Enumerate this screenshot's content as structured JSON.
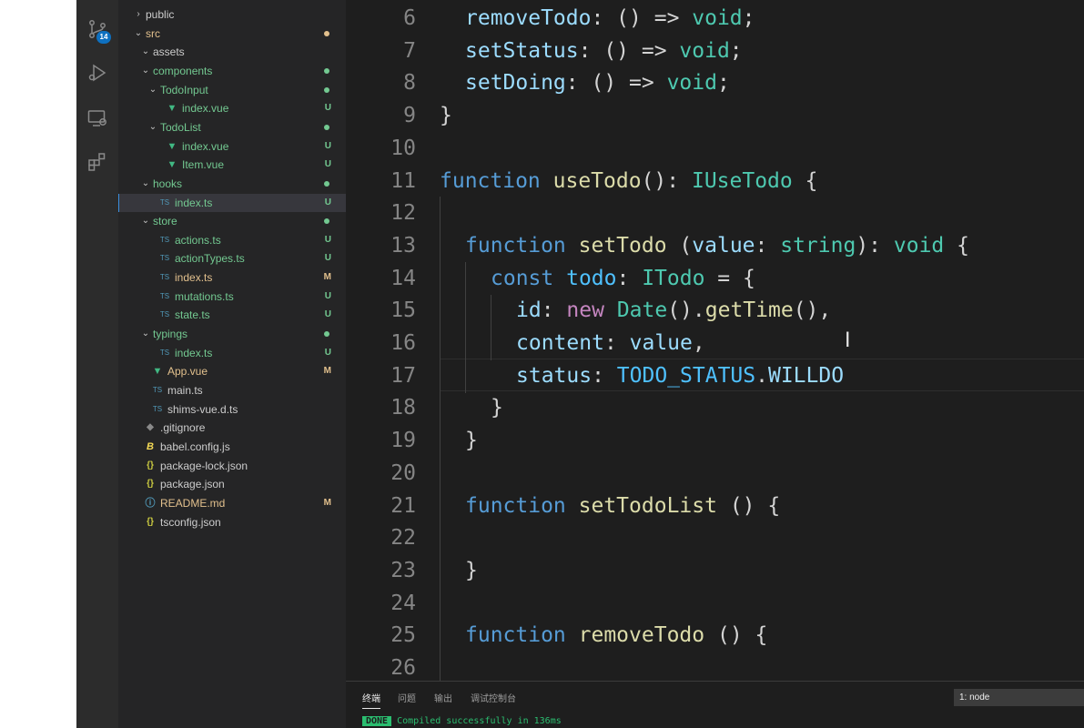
{
  "activity_bar": {
    "badge": "14",
    "icons": [
      "source-control-icon",
      "run-debug-icon",
      "remote-explorer-icon",
      "extensions-icon"
    ]
  },
  "explorer": {
    "items": [
      {
        "label": "public",
        "depth": 0,
        "type": "folder",
        "expanded": false,
        "status": ""
      },
      {
        "label": "src",
        "depth": 0,
        "type": "folder",
        "expanded": true,
        "status": "dot-yellow"
      },
      {
        "label": "assets",
        "depth": 1,
        "type": "folder",
        "expanded": true,
        "status": ""
      },
      {
        "label": "components",
        "depth": 1,
        "type": "folder",
        "expanded": true,
        "status": "dot-green"
      },
      {
        "label": "TodoInput",
        "depth": 2,
        "type": "folder",
        "expanded": true,
        "status": "dot-green"
      },
      {
        "label": "index.vue",
        "depth": 3,
        "type": "vue",
        "status": "U"
      },
      {
        "label": "TodoList",
        "depth": 2,
        "type": "folder",
        "expanded": true,
        "status": "dot-green"
      },
      {
        "label": "index.vue",
        "depth": 3,
        "type": "vue",
        "status": "U"
      },
      {
        "label": "Item.vue",
        "depth": 3,
        "type": "vue",
        "status": "U"
      },
      {
        "label": "hooks",
        "depth": 1,
        "type": "folder",
        "expanded": true,
        "status": "dot-green"
      },
      {
        "label": "index.ts",
        "depth": 2,
        "type": "ts",
        "status": "U",
        "selected": true
      },
      {
        "label": "store",
        "depth": 1,
        "type": "folder",
        "expanded": true,
        "status": "dot-green"
      },
      {
        "label": "actions.ts",
        "depth": 2,
        "type": "ts",
        "status": "U"
      },
      {
        "label": "actionTypes.ts",
        "depth": 2,
        "type": "ts",
        "status": "U"
      },
      {
        "label": "index.ts",
        "depth": 2,
        "type": "ts",
        "status": "M"
      },
      {
        "label": "mutations.ts",
        "depth": 2,
        "type": "ts",
        "status": "U"
      },
      {
        "label": "state.ts",
        "depth": 2,
        "type": "ts",
        "status": "U"
      },
      {
        "label": "typings",
        "depth": 1,
        "type": "folder",
        "expanded": true,
        "status": "dot-green"
      },
      {
        "label": "index.ts",
        "depth": 2,
        "type": "ts",
        "status": "U"
      },
      {
        "label": "App.vue",
        "depth": 1,
        "type": "vue",
        "status": "M"
      },
      {
        "label": "main.ts",
        "depth": 1,
        "type": "ts",
        "status": ""
      },
      {
        "label": "shims-vue.d.ts",
        "depth": 1,
        "type": "ts",
        "status": ""
      },
      {
        "label": ".gitignore",
        "depth": 0,
        "type": "git",
        "status": ""
      },
      {
        "label": "babel.config.js",
        "depth": 0,
        "type": "babel",
        "status": ""
      },
      {
        "label": "package-lock.json",
        "depth": 0,
        "type": "json",
        "status": ""
      },
      {
        "label": "package.json",
        "depth": 0,
        "type": "json",
        "status": ""
      },
      {
        "label": "README.md",
        "depth": 0,
        "type": "info",
        "status": "M"
      },
      {
        "label": "tsconfig.json",
        "depth": 0,
        "type": "json",
        "status": ""
      }
    ]
  },
  "editor": {
    "lines": [
      {
        "n": "6",
        "indent": 1,
        "tokens": [
          {
            "t": "removeTodo",
            "c": "prop"
          },
          {
            "t": ": () => ",
            "c": "p"
          },
          {
            "t": "void",
            "c": "ty"
          },
          {
            "t": ";",
            "c": "p"
          }
        ]
      },
      {
        "n": "7",
        "indent": 1,
        "tokens": [
          {
            "t": "setStatus",
            "c": "prop"
          },
          {
            "t": ": () => ",
            "c": "p"
          },
          {
            "t": "void",
            "c": "ty"
          },
          {
            "t": ";",
            "c": "p"
          }
        ]
      },
      {
        "n": "8",
        "indent": 1,
        "tokens": [
          {
            "t": "setDoing",
            "c": "prop"
          },
          {
            "t": ": () => ",
            "c": "p"
          },
          {
            "t": "void",
            "c": "ty"
          },
          {
            "t": ";",
            "c": "p"
          }
        ]
      },
      {
        "n": "9",
        "indent": 0,
        "tokens": [
          {
            "t": "}",
            "c": "p"
          }
        ]
      },
      {
        "n": "10",
        "indent": 0,
        "tokens": []
      },
      {
        "n": "11",
        "indent": 0,
        "tokens": [
          {
            "t": "function",
            "c": "kw"
          },
          {
            "t": " ",
            "c": "p"
          },
          {
            "t": "useTodo",
            "c": "fn"
          },
          {
            "t": "(): ",
            "c": "p"
          },
          {
            "t": "IUseTodo",
            "c": "ty"
          },
          {
            "t": " {",
            "c": "p"
          }
        ]
      },
      {
        "n": "12",
        "indent": 0,
        "tokens": []
      },
      {
        "n": "13",
        "indent": 1,
        "tokens": [
          {
            "t": "function",
            "c": "kw"
          },
          {
            "t": " ",
            "c": "p"
          },
          {
            "t": "setTodo",
            "c": "fn"
          },
          {
            "t": " (",
            "c": "p"
          },
          {
            "t": "value",
            "c": "prop"
          },
          {
            "t": ": ",
            "c": "p"
          },
          {
            "t": "string",
            "c": "ty"
          },
          {
            "t": "): ",
            "c": "p"
          },
          {
            "t": "void",
            "c": "ty"
          },
          {
            "t": " {",
            "c": "p"
          }
        ]
      },
      {
        "n": "14",
        "indent": 2,
        "tokens": [
          {
            "t": "const",
            "c": "kw"
          },
          {
            "t": " ",
            "c": "p"
          },
          {
            "t": "todo",
            "c": "cst"
          },
          {
            "t": ": ",
            "c": "p"
          },
          {
            "t": "ITodo",
            "c": "ty"
          },
          {
            "t": " = {",
            "c": "p"
          }
        ]
      },
      {
        "n": "15",
        "indent": 3,
        "tokens": [
          {
            "t": "id",
            "c": "prop"
          },
          {
            "t": ": ",
            "c": "p"
          },
          {
            "t": "new",
            "c": "np"
          },
          {
            "t": " ",
            "c": "p"
          },
          {
            "t": "Date",
            "c": "ty"
          },
          {
            "t": "().",
            "c": "p"
          },
          {
            "t": "getTime",
            "c": "fn"
          },
          {
            "t": "(),",
            "c": "p"
          }
        ]
      },
      {
        "n": "16",
        "indent": 3,
        "tokens": [
          {
            "t": "content",
            "c": "prop"
          },
          {
            "t": ": ",
            "c": "p"
          },
          {
            "t": "value",
            "c": "prop"
          },
          {
            "t": ",",
            "c": "p"
          }
        ]
      },
      {
        "n": "17",
        "indent": 3,
        "tokens": [
          {
            "t": "status",
            "c": "prop"
          },
          {
            "t": ": ",
            "c": "p"
          },
          {
            "t": "TODO_STATUS",
            "c": "cst"
          },
          {
            "t": ".",
            "c": "p"
          },
          {
            "t": "WILLDO",
            "c": "prop"
          }
        ]
      },
      {
        "n": "18",
        "indent": 2,
        "tokens": [
          {
            "t": "}",
            "c": "p"
          }
        ]
      },
      {
        "n": "19",
        "indent": 1,
        "tokens": [
          {
            "t": "}",
            "c": "p"
          }
        ]
      },
      {
        "n": "20",
        "indent": 0,
        "tokens": []
      },
      {
        "n": "21",
        "indent": 1,
        "tokens": [
          {
            "t": "function",
            "c": "kw"
          },
          {
            "t": " ",
            "c": "p"
          },
          {
            "t": "setTodoList",
            "c": "fn"
          },
          {
            "t": " () {",
            "c": "p"
          }
        ]
      },
      {
        "n": "22",
        "indent": 0,
        "tokens": []
      },
      {
        "n": "23",
        "indent": 1,
        "tokens": [
          {
            "t": "}",
            "c": "p"
          }
        ]
      },
      {
        "n": "24",
        "indent": 0,
        "tokens": []
      },
      {
        "n": "25",
        "indent": 1,
        "tokens": [
          {
            "t": "function",
            "c": "kw"
          },
          {
            "t": " ",
            "c": "p"
          },
          {
            "t": "removeTodo",
            "c": "fn"
          },
          {
            "t": " () {",
            "c": "p"
          }
        ]
      },
      {
        "n": "26",
        "indent": 0,
        "tokens": []
      }
    ]
  },
  "panel": {
    "tabs": [
      "终端",
      "问题",
      "输出",
      "调试控制台"
    ],
    "terminal_select": "1: node",
    "done_label": "DONE",
    "message": "Compiled successfully in 136ms"
  },
  "colors": {
    "activity_bar": "#2c2c2c",
    "sidebar": "#252526",
    "editor": "#1e1e1e",
    "badge": "#0e70c0",
    "untracked": "#73c991",
    "modified": "#e2c08d",
    "done": "#2bbe70"
  }
}
